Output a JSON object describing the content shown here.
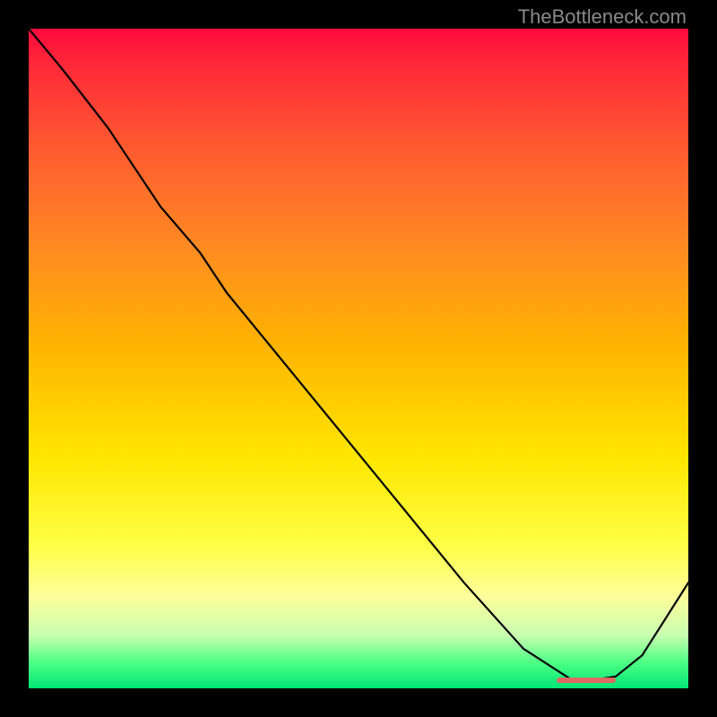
{
  "watermark": "TheBottleneck.com",
  "chart_data": {
    "type": "line",
    "title": "",
    "xlabel": "",
    "ylabel": "",
    "xlim": [
      0,
      100
    ],
    "ylim": [
      0,
      100
    ],
    "x": [
      0,
      5,
      12,
      20,
      26,
      30,
      48,
      66,
      75,
      82,
      84,
      89,
      93,
      100
    ],
    "values": [
      100,
      94,
      85,
      73,
      66,
      60,
      38,
      16,
      6,
      1.5,
      1.0,
      1.8,
      5.0,
      16
    ],
    "flat_segment": {
      "x_start": 80,
      "x_end": 89,
      "y": 1.2
    },
    "notes": "Curve descends from top-left, bends near x≈26, reaches a near-zero plateau around x≈80–89 (marked with a red bar), then rises toward the right edge."
  }
}
